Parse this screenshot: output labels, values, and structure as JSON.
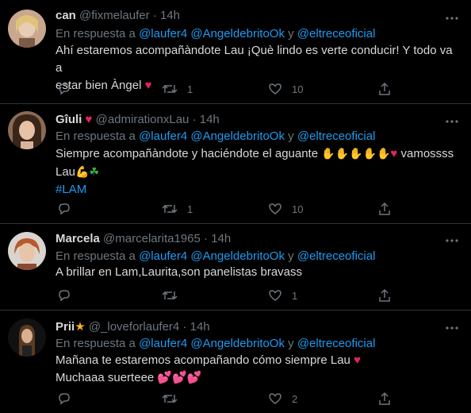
{
  "reply_prefix": "En respuesta a",
  "reply_conj": "y",
  "tweets": [
    {
      "name": "can",
      "name_badge": "",
      "handle": "@fixmelaufer",
      "time": "14h",
      "mentions": [
        "@laufer4",
        "@AngeldebritoOk",
        "@eltreceoficial"
      ],
      "body_line1": "Ahí estaremos acompañàndote Lau ¡Què lindo es verte conducir! Y todo va a",
      "body_line2": "estar bien Àngel",
      "hashtag": "",
      "retweets": "1",
      "likes": "10"
    },
    {
      "name": "Gîuli",
      "name_badge": "♥",
      "handle": "@admirationxLau",
      "time": "14h",
      "mentions": [
        "@laufer4",
        "@AngeldebritoOk",
        "@eltreceoficial"
      ],
      "body_line1": "Siempre acompañàndote y haciéndote el aguante",
      "body_line1_tail": "vamossss",
      "body_line2": "Lau",
      "hashtag": "#LAM",
      "retweets": "1",
      "likes": "10"
    },
    {
      "name": "Marcela",
      "name_badge": "",
      "handle": "@marcelarita1965",
      "time": "14h",
      "mentions": [
        "@laufer4",
        "@AngeldebritoOk",
        "@eltreceoficial"
      ],
      "body_line1": "A brillar en Lam,Laurita,son panelistas bravass",
      "body_line2": "",
      "hashtag": "",
      "retweets": "",
      "likes": "1"
    },
    {
      "name": "Prii",
      "name_badge": "★",
      "handle": "@_loveforlaufer4",
      "time": "14h",
      "mentions": [
        "@laufer4",
        "@AngeldebritoOk",
        "@eltreceoficial"
      ],
      "body_line1": "Mañana te estaremos acompañando cómo siempre Lau",
      "body_line2": "Muchaaa suerteee",
      "hashtag": "",
      "retweets": "",
      "likes": "2"
    }
  ],
  "colors": {
    "accent": "#1d9bf0",
    "muted": "#6e767d",
    "text": "#d9d9d9",
    "heart": "#e0245e",
    "divider": "#2f3336"
  }
}
